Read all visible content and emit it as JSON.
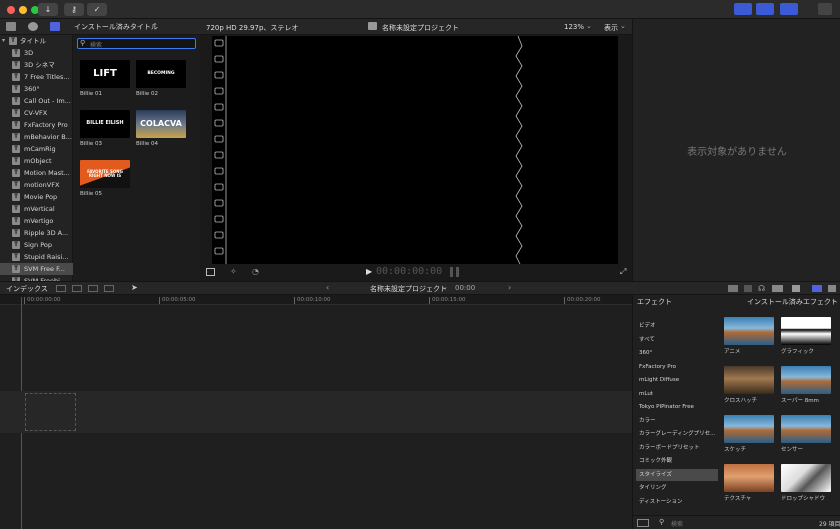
{
  "toolbar": {
    "library_title": "インストール済みタイトル",
    "library_chevron": "⌃"
  },
  "sidebar": {
    "root_label": "タイトル",
    "items": [
      "3D",
      "3D シネマ",
      "7 Free Titles...",
      "360°",
      "Call Out - Im...",
      "CV-VFX",
      "FxFactory Pro",
      "mBehavior B...",
      "mCamRig",
      "mObject",
      "Motion Mast...",
      "motionVFX",
      "Movie Pop",
      "mVertical",
      "mVertigo",
      "Ripple 3D A...",
      "Sign Pop",
      "Stupid Raisi...",
      "SVM Free F...",
      "SVM Freebi"
    ],
    "selected_index": 18
  },
  "browser": {
    "search_placeholder": "検索",
    "clips": [
      {
        "label": "Billie 01",
        "text": "LIFT"
      },
      {
        "label": "Billie 02",
        "text": "BECOMING"
      },
      {
        "label": "Billie 03",
        "text": "BILLIE EILISH"
      },
      {
        "label": "Billie 04",
        "text": "COLACVA"
      },
      {
        "label": "Billie 05",
        "text": "FAVORITE SONG RIGHT NOW IS"
      }
    ]
  },
  "viewer": {
    "format": "720p HD 29.97p、ステレオ",
    "project_name": "名称未設定プロジェクト",
    "zoom": "123%",
    "view_menu": "表示",
    "timecode": "00:00:00:00"
  },
  "inspector": {
    "empty_message": "表示対象がありません"
  },
  "timeline": {
    "index_label": "インデックス",
    "project_name": "名称未設定プロジェクト",
    "duration": "00:00",
    "ruler": [
      "00:00:00:00",
      "00:00:05:00",
      "00:00:10:00",
      "00:00:15:00",
      "00:00:20:00"
    ]
  },
  "effects": {
    "header": "エフェクト",
    "installed": "インストール済みエフェクト",
    "categories": [
      "ビデオ",
      "すべて",
      "360°",
      "FxFactory Pro",
      "mLight Diffuse",
      "mLut",
      "Tokyo PIPinator Free",
      "カラー",
      "カラーグレーディングプリセ...",
      "カラーボードプリセット",
      "コミック外観",
      "スタイライズ",
      "タイリング",
      "ディストーション"
    ],
    "selected_index": 11,
    "items": [
      {
        "label": "アニメ"
      },
      {
        "label": "グラフィック"
      },
      {
        "label": "クロスハッチ"
      },
      {
        "label": "スーパー 8mm"
      },
      {
        "label": "スケッチ"
      },
      {
        "label": "センサー"
      },
      {
        "label": "テクスチャ"
      },
      {
        "label": "ドロップシャドウ"
      }
    ],
    "count": "29 項目",
    "search_placeholder": "検索"
  }
}
